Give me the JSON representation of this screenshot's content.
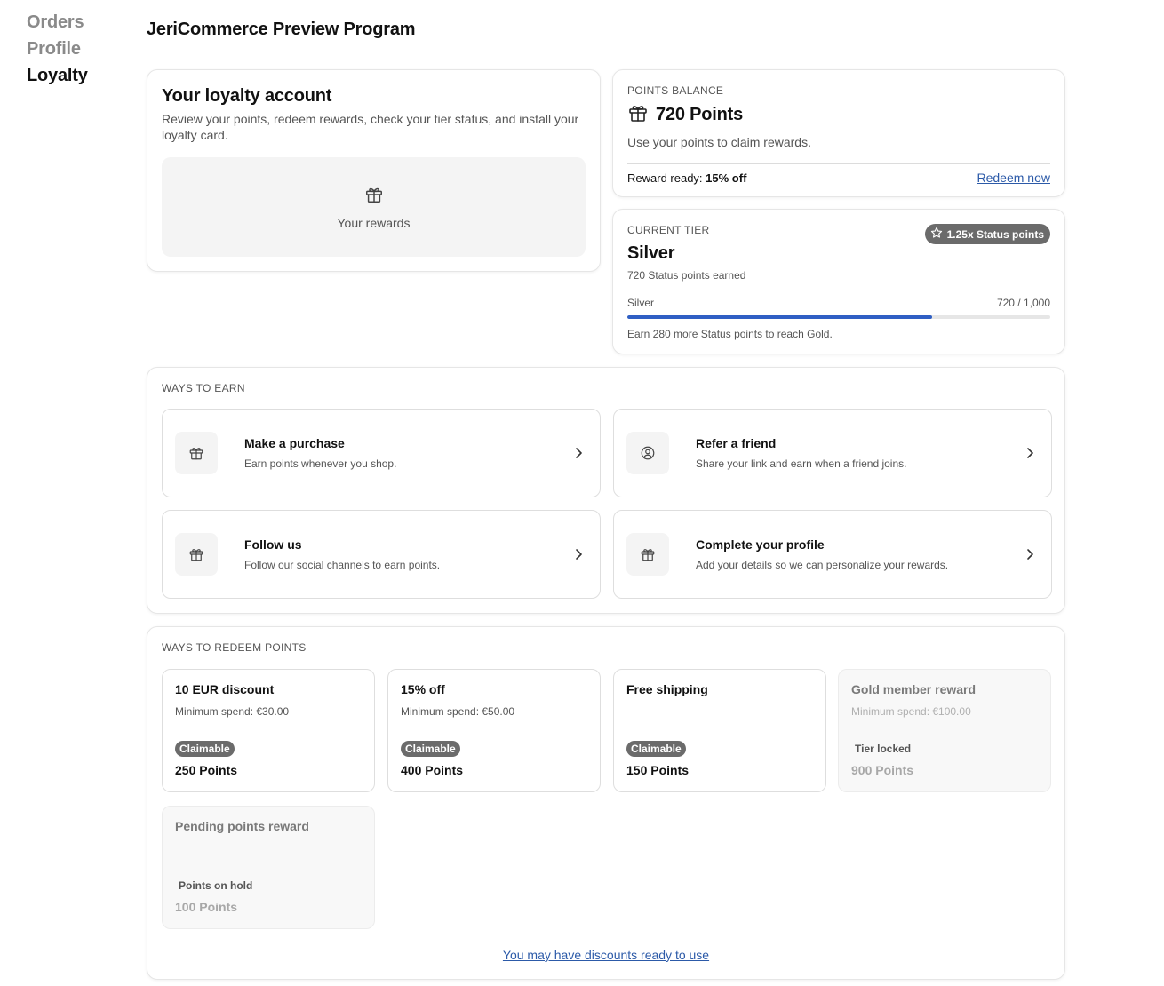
{
  "nav": {
    "items": [
      {
        "label": "Orders"
      },
      {
        "label": "Profile"
      },
      {
        "label": "Loyalty"
      }
    ]
  },
  "page": {
    "title": "JeriCommerce Preview Program"
  },
  "account": {
    "heading": "Your loyalty account",
    "description": "Review your points, redeem rewards, check your tier status, and install your loyalty card.",
    "rewards_label": "Your rewards"
  },
  "balance": {
    "eyebrow": "POINTS BALANCE",
    "points": "720 Points",
    "subtitle": "Use your points to claim rewards.",
    "reward_ready_prefix": "Reward ready:",
    "reward_ready_value": "15% off",
    "redeem_link": "Redeem now"
  },
  "tier": {
    "eyebrow": "CURRENT TIER",
    "badge": "1.25x Status points",
    "name": "Silver",
    "earned": "720 Status points earned",
    "progress_label_left": "Silver",
    "progress_label_right": "720 / 1,000",
    "progress_fraction": 0.72,
    "hint": "Earn 280 more Status points to reach Gold."
  },
  "earn": {
    "heading": "WAYS TO EARN",
    "items": [
      {
        "title": "Make a purchase",
        "desc": "Earn points whenever you shop.",
        "icon": "gift-icon"
      },
      {
        "title": "Refer a friend",
        "desc": "Share your link and earn when a friend joins.",
        "icon": "user-circle-icon"
      },
      {
        "title": "Follow us",
        "desc": "Follow our social channels to earn points.",
        "icon": "gift-icon"
      },
      {
        "title": "Complete your profile",
        "desc": "Add your details so we can personalize your rewards.",
        "icon": "gift-icon"
      }
    ]
  },
  "redeem": {
    "heading": "WAYS TO REDEEM POINTS",
    "items": [
      {
        "title": "10 EUR discount",
        "min": "Minimum spend: €30.00",
        "status": "Claimable",
        "points": "250 Points"
      },
      {
        "title": "15% off",
        "min": "Minimum spend: €50.00",
        "status": "Claimable",
        "points": "400 Points"
      },
      {
        "title": "Free shipping",
        "min": "",
        "status": "Claimable",
        "points": "150 Points"
      },
      {
        "title": "Gold member reward",
        "min": "Minimum spend: €100.00",
        "status": "Tier locked",
        "points": "900 Points"
      },
      {
        "title": "Pending points reward",
        "min": "",
        "status": "Points on hold",
        "points": "100 Points"
      }
    ],
    "bottom_link": "You may have discounts ready to use"
  },
  "colors": {
    "accent": "#2f5fc4",
    "link": "#2c5aa8",
    "badge": "#6b6b6b"
  }
}
